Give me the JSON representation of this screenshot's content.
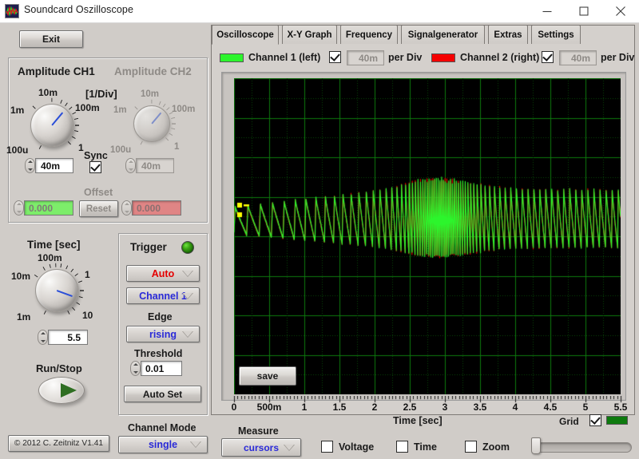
{
  "window": {
    "title": "Soundcard Oszilloscope",
    "icon": "waveform-app-icon",
    "minimize": "minimize-icon",
    "maximize": "maximize-icon",
    "close": "close-icon"
  },
  "left_panel": {
    "exit_button": "Exit",
    "copyright": "© 2012  C. Zeitnitz V1.41",
    "amplitude": {
      "ch1_title": "Amplitude CH1",
      "ch2_title": "Amplitude CH2",
      "per_div_label": "[1/Div]",
      "knob_ticks": [
        "100u",
        "1m",
        "10m",
        "100m",
        "1"
      ],
      "ch1_value": "40m",
      "ch2_value": "40m",
      "sync_label": "Sync",
      "sync_checked": true,
      "offset_label": "Offset",
      "offset_ch1": "0.000",
      "offset_ch2": "0.000",
      "reset_button": "Reset"
    },
    "time": {
      "title": "Time [sec]",
      "knob_ticks": [
        "1m",
        "10m",
        "100m",
        "1",
        "10"
      ],
      "value": "5.5"
    },
    "run_stop": {
      "label": "Run/Stop",
      "state": "running"
    },
    "trigger": {
      "title": "Trigger",
      "led": "on",
      "mode": "Auto",
      "source": "Channel 1",
      "edge_label": "Edge",
      "edge": "rising",
      "threshold_label": "Threshold",
      "threshold": "0.01",
      "auto_set_button": "Auto Set"
    },
    "channel_mode": {
      "label": "Channel Mode",
      "value": "single"
    }
  },
  "tabs": [
    {
      "label": "Oscilloscope",
      "active": true
    },
    {
      "label": "X-Y Graph",
      "active": false
    },
    {
      "label": "Frequency",
      "active": false
    },
    {
      "label": "Signalgenerator",
      "active": false
    },
    {
      "label": "Extras",
      "active": false
    },
    {
      "label": "Settings",
      "active": false
    }
  ],
  "channel_bar": {
    "ch1": {
      "name": "Channel 1 (left)",
      "color": "#2cf52c",
      "enabled": true,
      "value": "40m",
      "per_div": "per Div"
    },
    "ch2": {
      "name": "Channel 2 (right)",
      "color": "#f50000",
      "enabled": true,
      "value": "40m",
      "per_div": "per Div"
    }
  },
  "scope": {
    "save_button": "save",
    "xaxis_label": "Time [sec]",
    "grid_label": "Grid",
    "grid_checked": true,
    "grid_color": "#0a7a0a",
    "background": "#000000",
    "cursor_color": "#ffff00"
  },
  "bottom_bar": {
    "measure_label": "Measure",
    "measure_value": "cursors",
    "voltage_label": "Voltage",
    "voltage_checked": false,
    "time_label": "Time",
    "time_checked": false,
    "zoom_label": "Zoom",
    "zoom_checked": false,
    "zoom_slider_value": 0
  },
  "chart_data": {
    "type": "line",
    "title": "Oscilloscope trace",
    "xlabel": "Time [sec]",
    "ylabel": "",
    "xlim": [
      0,
      5.5
    ],
    "ylim": [
      -0.2,
      0.2
    ],
    "xticks": [
      "0",
      "500m",
      "1",
      "1.5",
      "2",
      "2.5",
      "3",
      "3.5",
      "4",
      "4.5",
      "5",
      "5.5"
    ],
    "xtick_values": [
      0,
      0.5,
      1,
      1.5,
      2,
      2.5,
      3,
      3.5,
      4,
      4.5,
      5,
      5.5
    ],
    "grid": true,
    "legend": [
      "Channel 1 (left)",
      "Channel 2 (right)"
    ],
    "series": [
      {
        "name": "Channel 1 (left)",
        "color": "#2cf52c",
        "description": "Sawtooth pulse train, frequency sweeping upward from ~6 Hz at t=0 to a dense burst around t=2.6-3.2 s then settling near ~9 Hz; amplitude envelope grows from 0.04 to 0.09 and narrows after the burst."
      },
      {
        "name": "Channel 2 (right)",
        "color": "#f50000",
        "description": "Nearly identical sawtooth train, slightly offset, mostly hidden behind Channel 1 and visible as red fringes on the pulse edges."
      }
    ],
    "cursors": [
      {
        "name": "cursor-1",
        "y": 0.015,
        "color": "#ffff00"
      },
      {
        "name": "cursor-2",
        "y": -0.005,
        "color": "#ffff00"
      }
    ]
  }
}
